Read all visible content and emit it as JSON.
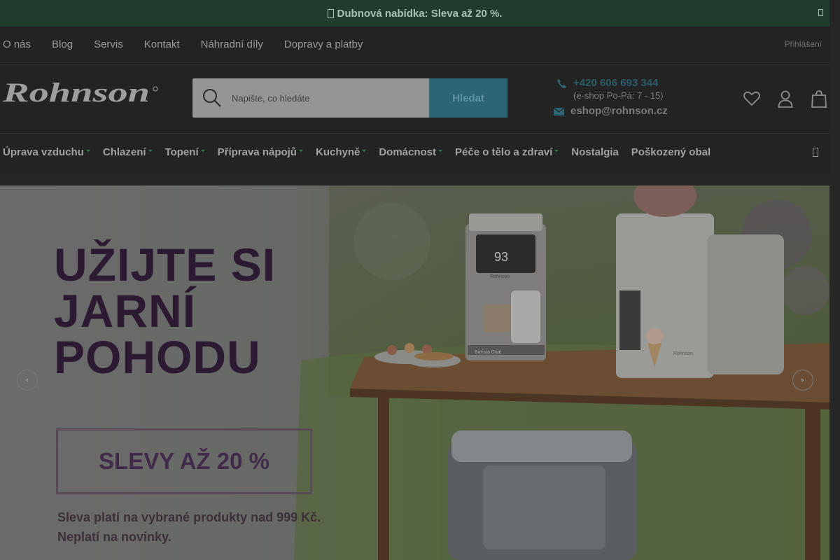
{
  "promo": {
    "text": "Dubnová nabídka: Sleva až 20 %."
  },
  "topnav": {
    "links": [
      "O nás",
      "Blog",
      "Servis",
      "Kontakt",
      "Náhradní díly",
      "Dopravy a platby"
    ],
    "login": "Přihlášení"
  },
  "header": {
    "logo_text": "Rohnson",
    "search": {
      "placeholder": "Napište, co hledáte",
      "button": "Hledat"
    },
    "contact": {
      "phone": "+420 606 693 344",
      "hours": "(e-shop Po-Pá: 7 - 15)",
      "email": "eshop@rohnson.cz"
    },
    "icons": [
      "heart-icon",
      "user-icon",
      "bag-icon"
    ]
  },
  "categories": [
    {
      "label": "Úprava vzduchu",
      "dropdown": true
    },
    {
      "label": "Chlazení",
      "dropdown": true
    },
    {
      "label": "Topení",
      "dropdown": true
    },
    {
      "label": "Příprava nápojů",
      "dropdown": true
    },
    {
      "label": "Kuchyně",
      "dropdown": true
    },
    {
      "label": "Domácnost",
      "dropdown": true
    },
    {
      "label": "Péče o tělo a zdraví",
      "dropdown": true
    },
    {
      "label": "Nostalgia",
      "dropdown": false
    },
    {
      "label": "Poškozený obal",
      "dropdown": false
    }
  ],
  "hero": {
    "title_lines": [
      "UŽIJTE SI",
      "JARNÍ",
      "POHODU"
    ],
    "discount": "SLEVY AŽ 20 %",
    "fine_print": [
      "Sleva platí na vybrané produkty nad 999 Kč.",
      "Neplatí na novinky."
    ],
    "machine_display": "93",
    "machine_brand": "Rohnson",
    "machine_model": "Barista Dual",
    "icecream_brand": "Rohnson"
  },
  "colors": {
    "promo_bg": "#1e3d2d",
    "header_bg": "#232323",
    "accent": "#2c6574",
    "link_accent": "#2c5c6a",
    "dropdown_marker": "#2e7d4f",
    "hero_text": "#2c1a33"
  }
}
